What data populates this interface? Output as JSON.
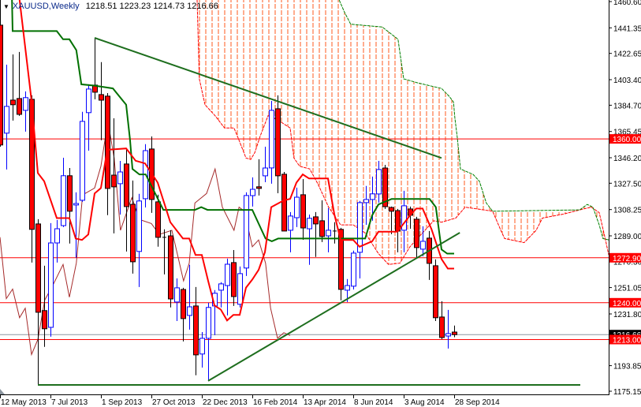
{
  "header": {
    "symbol_timeframe": "XAUUSD,Weekly",
    "ohlc_readout": "1218.51 1223.23 1214.73 1216.66",
    "menu_icon": "triangle-down-icon"
  },
  "colors": {
    "bear_fill": "#FF0000",
    "bull_outline": "#0000FF",
    "tenkan": "#FF0000",
    "kijun": "#007000",
    "chikou": "#A52A2A",
    "cloud_hatch": "#FF5A1E",
    "span_a": "#FF0000",
    "span_b": "#008000",
    "trendline": "#1E6E1E",
    "level_line": "#FF0000",
    "bid_line": "#8C96A0"
  },
  "chart_data": {
    "type": "candlestick",
    "title": "XAUUSD,Weekly",
    "ylim": [
      1175.15,
      1460.6
    ],
    "y_ticks": [
      "1460.60",
      "1441.35",
      "1422.65",
      "1403.40",
      "1384.70",
      "1365.45",
      "1346.20",
      "1327.50",
      "1308.25",
      "1289.00",
      "1270.30",
      "1251.05",
      "1231.80",
      "1193.85",
      "1175.15"
    ],
    "x_labels": [
      {
        "bar": 0,
        "label": "12 May 2013"
      },
      {
        "bar": 8,
        "label": "7 Jul 2013"
      },
      {
        "bar": 16,
        "label": "1 Sep 2013"
      },
      {
        "bar": 24,
        "label": "27 Oct 2013"
      },
      {
        "bar": 32,
        "label": "22 Dec 2013"
      },
      {
        "bar": 40,
        "label": "16 Feb 2014"
      },
      {
        "bar": 48,
        "label": "13 Apr 2014"
      },
      {
        "bar": 56,
        "label": "8 Jun 2014"
      },
      {
        "bar": 64,
        "label": "3 Aug 2014"
      },
      {
        "bar": 72,
        "label": "28 Sep 2014"
      }
    ],
    "ohlc_order": [
      "open",
      "high",
      "low",
      "close"
    ],
    "candles": [
      [
        1443.3,
        1467.0,
        1354.3,
        1355.5
      ],
      [
        1364.2,
        1414.4,
        1337.6,
        1383.8
      ],
      [
        1388.4,
        1421.9,
        1373.4,
        1385.0
      ],
      [
        1389.6,
        1423.7,
        1376.9,
        1378.0
      ],
      [
        1380.9,
        1394.8,
        1365.3,
        1390.2
      ],
      [
        1389.0,
        1391.9,
        1269.4,
        1293.7
      ],
      [
        1297.7,
        1301.2,
        1179.8,
        1233.0
      ],
      [
        1234.2,
        1267.1,
        1207.6,
        1220.9
      ],
      [
        1222.0,
        1298.3,
        1215.1,
        1283.8
      ],
      [
        1283.8,
        1300.6,
        1269.4,
        1294.2
      ],
      [
        1296.5,
        1346.2,
        1295.4,
        1333.0
      ],
      [
        1333.0,
        1338.7,
        1283.3,
        1307.0
      ],
      [
        1311.6,
        1320.8,
        1272.9,
        1312.7
      ],
      [
        1315.0,
        1379.8,
        1313.9,
        1372.8
      ],
      [
        1379.2,
        1400.0,
        1351.4,
        1396.5
      ],
      [
        1399.4,
        1433.5,
        1389.0,
        1394.2
      ],
      [
        1392.5,
        1416.2,
        1359.0,
        1388.4
      ],
      [
        1391.3,
        1393.6,
        1304.1,
        1323.7
      ],
      [
        1333.5,
        1375.1,
        1290.8,
        1324.9
      ],
      [
        1327.2,
        1343.9,
        1304.6,
        1335.8
      ],
      [
        1341.6,
        1352.6,
        1277.5,
        1310.4
      ],
      [
        1312.1,
        1329.5,
        1261.3,
        1270.0
      ],
      [
        1277.5,
        1319.7,
        1251.5,
        1314.5
      ],
      [
        1316.2,
        1356.1,
        1309.8,
        1351.4
      ],
      [
        1352.6,
        1361.8,
        1305.8,
        1315.6
      ],
      [
        1313.9,
        1319.1,
        1281.0,
        1287.9
      ],
      [
        1287.9,
        1293.7,
        1260.7,
        1287.9
      ],
      [
        1289.0,
        1293.1,
        1236.5,
        1242.8
      ],
      [
        1240.5,
        1257.8,
        1226.6,
        1250.9
      ],
      [
        1249.7,
        1250.9,
        1211.6,
        1228.4
      ],
      [
        1230.7,
        1267.7,
        1220.3,
        1237.0
      ],
      [
        1237.6,
        1251.5,
        1186.8,
        1201.8
      ],
      [
        1202.4,
        1218.5,
        1192.5,
        1213.9
      ],
      [
        1213.9,
        1239.9,
        1182.7,
        1236.5
      ],
      [
        1237.6,
        1249.2,
        1216.2,
        1246.9
      ],
      [
        1249.2,
        1255.0,
        1236.5,
        1253.8
      ],
      [
        1252.6,
        1272.3,
        1230.7,
        1268.2
      ],
      [
        1269.4,
        1278.6,
        1237.6,
        1244.5
      ],
      [
        1238.8,
        1266.5,
        1236.5,
        1261.3
      ],
      [
        1265.4,
        1320.8,
        1259.6,
        1318.5
      ],
      [
        1318.5,
        1331.8,
        1310.4,
        1323.1
      ],
      [
        1324.9,
        1345.1,
        1318.5,
        1323.7
      ],
      [
        1333.0,
        1354.3,
        1328.3,
        1338.7
      ],
      [
        1338.7,
        1387.8,
        1327.2,
        1380.9
      ],
      [
        1382.1,
        1391.9,
        1320.2,
        1333.0
      ],
      [
        1334.1,
        1335.8,
        1292.5,
        1292.5
      ],
      [
        1293.1,
        1306.4,
        1276.9,
        1303.5
      ],
      [
        1302.3,
        1324.3,
        1295.4,
        1317.3
      ],
      [
        1319.1,
        1330.6,
        1286.1,
        1294.8
      ],
      [
        1294.2,
        1304.6,
        1267.7,
        1301.8
      ],
      [
        1302.9,
        1306.4,
        1273.5,
        1297.7
      ],
      [
        1300.0,
        1315.0,
        1284.4,
        1288.5
      ],
      [
        1289.0,
        1309.3,
        1276.9,
        1293.1
      ],
      [
        1292.5,
        1298.9,
        1283.3,
        1292.5
      ],
      [
        1293.7,
        1294.8,
        1241.7,
        1249.7
      ],
      [
        1249.2,
        1257.3,
        1240.5,
        1252.6
      ],
      [
        1252.1,
        1278.1,
        1249.7,
        1276.3
      ],
      [
        1276.9,
        1314.5,
        1257.8,
        1313.3
      ],
      [
        1313.3,
        1325.5,
        1297.1,
        1315.6
      ],
      [
        1315.6,
        1332.4,
        1300.0,
        1319.7
      ],
      [
        1319.7,
        1343.9,
        1313.3,
        1337.6
      ],
      [
        1338.7,
        1341.0,
        1308.7,
        1310.4
      ],
      [
        1309.8,
        1310.4,
        1290.2,
        1307.0
      ],
      [
        1307.5,
        1308.7,
        1276.9,
        1292.5
      ],
      [
        1293.1,
        1322.0,
        1276.9,
        1311.0
      ],
      [
        1308.7,
        1310.4,
        1294.2,
        1304.1
      ],
      [
        1301.2,
        1302.9,
        1272.9,
        1280.4
      ],
      [
        1279.2,
        1296.0,
        1274.0,
        1285.0
      ],
      [
        1287.3,
        1292.5,
        1256.7,
        1268.8
      ],
      [
        1267.1,
        1271.7,
        1226.6,
        1229.0
      ],
      [
        1229.5,
        1241.1,
        1213.3,
        1214.5
      ],
      [
        1215.6,
        1234.7,
        1206.4,
        1217.4
      ],
      [
        1218.51,
        1223.23,
        1214.73,
        1216.66
      ]
    ],
    "indicators": {
      "tenkan": [
        [
          3.1,
          1462
        ],
        [
          5,
          1388
        ],
        [
          6,
          1335
        ],
        [
          7,
          1329
        ],
        [
          9,
          1302
        ],
        [
          11,
          1302
        ],
        [
          12,
          1287
        ],
        [
          13,
          1286
        ],
        [
          14,
          1290
        ],
        [
          15,
          1320
        ],
        [
          16,
          1324
        ],
        [
          17,
          1352
        ],
        [
          20,
          1353
        ],
        [
          21.5,
          1344
        ],
        [
          23,
          1342
        ],
        [
          25,
          1328
        ],
        [
          27,
          1299
        ],
        [
          29,
          1287
        ],
        [
          30,
          1287
        ],
        [
          31,
          1275
        ],
        [
          32,
          1275
        ],
        [
          33,
          1256
        ],
        [
          34,
          1238
        ],
        [
          35,
          1235
        ],
        [
          36,
          1227
        ],
        [
          37,
          1231
        ],
        [
          38,
          1231
        ],
        [
          39,
          1251
        ],
        [
          40,
          1257
        ],
        [
          41,
          1264
        ],
        [
          42,
          1277
        ],
        [
          43,
          1310
        ],
        [
          45,
          1315
        ],
        [
          46,
          1316
        ],
        [
          47,
          1328
        ],
        [
          48,
          1334
        ],
        [
          49,
          1331
        ],
        [
          52,
          1331
        ],
        [
          53,
          1305
        ],
        [
          54,
          1286
        ],
        [
          56,
          1286
        ],
        [
          57,
          1281
        ],
        [
          59,
          1285
        ],
        [
          60,
          1292
        ],
        [
          63,
          1292
        ],
        [
          65,
          1304
        ],
        [
          66,
          1309
        ],
        [
          67,
          1309
        ],
        [
          68.4,
          1294
        ],
        [
          70,
          1272
        ],
        [
          71,
          1265
        ],
        [
          72,
          1265
        ]
      ],
      "kijun": [
        [
          1.9,
          1462
        ],
        [
          2,
          1439
        ],
        [
          9,
          1439
        ],
        [
          10,
          1433
        ],
        [
          11,
          1433
        ],
        [
          12.1,
          1425
        ],
        [
          12.9,
          1400
        ],
        [
          15,
          1399
        ],
        [
          17.9,
          1397
        ],
        [
          20,
          1385
        ],
        [
          20.6,
          1360
        ],
        [
          21,
          1338
        ],
        [
          22.1,
          1334
        ],
        [
          23.1,
          1334
        ],
        [
          25.9,
          1308
        ],
        [
          30.9,
          1308
        ],
        [
          31.9,
          1310
        ],
        [
          32.9,
          1308
        ],
        [
          40,
          1308
        ],
        [
          42.1,
          1287
        ],
        [
          43.1,
          1285
        ],
        [
          44.1,
          1287
        ],
        [
          57.9,
          1287
        ],
        [
          59,
          1304
        ],
        [
          60,
          1312
        ],
        [
          62.1,
          1316
        ],
        [
          68.1,
          1316
        ],
        [
          69.1,
          1310
        ],
        [
          70,
          1279
        ],
        [
          70.9,
          1276
        ],
        [
          72,
          1276
        ]
      ],
      "chikou": [
        [
          0,
          1288
        ],
        [
          1,
          1243
        ],
        [
          2,
          1250
        ],
        [
          3.1,
          1229
        ],
        [
          4,
          1236
        ],
        [
          5,
          1202
        ],
        [
          6,
          1213
        ],
        [
          7.1,
          1242
        ],
        [
          8.4,
          1253
        ],
        [
          10,
          1268
        ],
        [
          11,
          1244
        ],
        [
          12.1,
          1269
        ],
        [
          13.1,
          1319
        ],
        [
          15,
          1324
        ],
        [
          16,
          1340
        ],
        [
          17.1,
          1373
        ],
        [
          18.1,
          1346
        ],
        [
          19.1,
          1293
        ],
        [
          20.9,
          1317
        ],
        [
          22.1,
          1301
        ],
        [
          24,
          1298
        ],
        [
          25.25,
          1290
        ],
        [
          27.25,
          1293
        ],
        [
          29.1,
          1256
        ],
        [
          30,
          1269
        ],
        [
          30.9,
          1313
        ],
        [
          32.75,
          1320
        ],
        [
          34.1,
          1338
        ],
        [
          35.25,
          1310
        ],
        [
          37.1,
          1293
        ],
        [
          37.9,
          1310
        ],
        [
          38.75,
          1307
        ],
        [
          40,
          1281
        ],
        [
          41,
          1286
        ],
        [
          42.1,
          1269
        ],
        [
          42.9,
          1236
        ],
        [
          44,
          1214
        ],
        [
          45,
          1218
        ],
        [
          46,
          1216
        ]
      ],
      "span_a": [
        [
          31.25,
          1462
        ],
        [
          31.6,
          1404
        ],
        [
          32.5,
          1385
        ],
        [
          34.1,
          1377
        ],
        [
          35.6,
          1368
        ],
        [
          37.1,
          1368
        ],
        [
          37.9,
          1359
        ],
        [
          39,
          1346
        ],
        [
          39.75,
          1345
        ],
        [
          40.4,
          1350
        ],
        [
          41.25,
          1362
        ],
        [
          42.5,
          1377
        ],
        [
          44,
          1374
        ],
        [
          46,
          1368
        ],
        [
          46.6,
          1346
        ],
        [
          47.5,
          1340
        ],
        [
          49.1,
          1338
        ],
        [
          50.4,
          1327
        ],
        [
          52.1,
          1310
        ],
        [
          54,
          1297
        ],
        [
          56,
          1297
        ],
        [
          57.9,
          1291
        ],
        [
          60,
          1276
        ],
        [
          61.6,
          1268
        ],
        [
          63.4,
          1269
        ],
        [
          65,
          1281
        ],
        [
          68.75,
          1300
        ],
        [
          70,
          1299
        ],
        [
          72.25,
          1302
        ],
        [
          73.75,
          1310
        ],
        [
          78.1,
          1307
        ],
        [
          79.4,
          1293
        ],
        [
          80,
          1287
        ],
        [
          83.1,
          1284
        ],
        [
          85,
          1293
        ],
        [
          86,
          1302
        ],
        [
          89.4,
          1305
        ],
        [
          91.9,
          1308
        ],
        [
          93.75,
          1310
        ],
        [
          95,
          1306
        ],
        [
          96,
          1286
        ],
        [
          96.5,
          1275
        ]
      ],
      "span_b": [
        [
          31,
          1479
        ],
        [
          53.5,
          1479
        ],
        [
          53.75,
          1462
        ],
        [
          54.6,
          1453
        ],
        [
          55.6,
          1444
        ],
        [
          60.6,
          1442
        ],
        [
          63.1,
          1433
        ],
        [
          64,
          1404
        ],
        [
          66.25,
          1401
        ],
        [
          68.1,
          1399
        ],
        [
          70,
          1397
        ],
        [
          71.25,
          1391
        ],
        [
          71.9,
          1387
        ],
        [
          72.1,
          1376
        ],
        [
          72.5,
          1361
        ],
        [
          73,
          1338
        ],
        [
          75,
          1334
        ],
        [
          76,
          1329
        ],
        [
          77.1,
          1313
        ],
        [
          78.1,
          1307
        ],
        [
          91.9,
          1308
        ],
        [
          93.1,
          1312
        ],
        [
          94,
          1310
        ],
        [
          95,
          1297
        ],
        [
          95.6,
          1287
        ],
        [
          96.5,
          1286
        ]
      ]
    },
    "trendlines": [
      {
        "name": "descending-resistance",
        "from": [
          15,
          1434
        ],
        "to": [
          70,
          1346
        ]
      },
      {
        "name": "ascending-support",
        "from": [
          33,
          1182.7
        ],
        "to": [
          72.9,
          1291.3
        ]
      },
      {
        "name": "horizontal-support",
        "from": [
          6,
          1179.8
        ],
        "to": [
          92,
          1179.8
        ]
      }
    ],
    "levels": [
      {
        "price": 1360.0,
        "label": "1360.00"
      },
      {
        "price": 1272.9,
        "label": "1272.90"
      },
      {
        "price": 1240.0,
        "label": "1240.00"
      },
      {
        "price": 1213.0,
        "label": "1213.00"
      }
    ],
    "bid": {
      "price": 1216.66,
      "label": "1216.66"
    }
  }
}
